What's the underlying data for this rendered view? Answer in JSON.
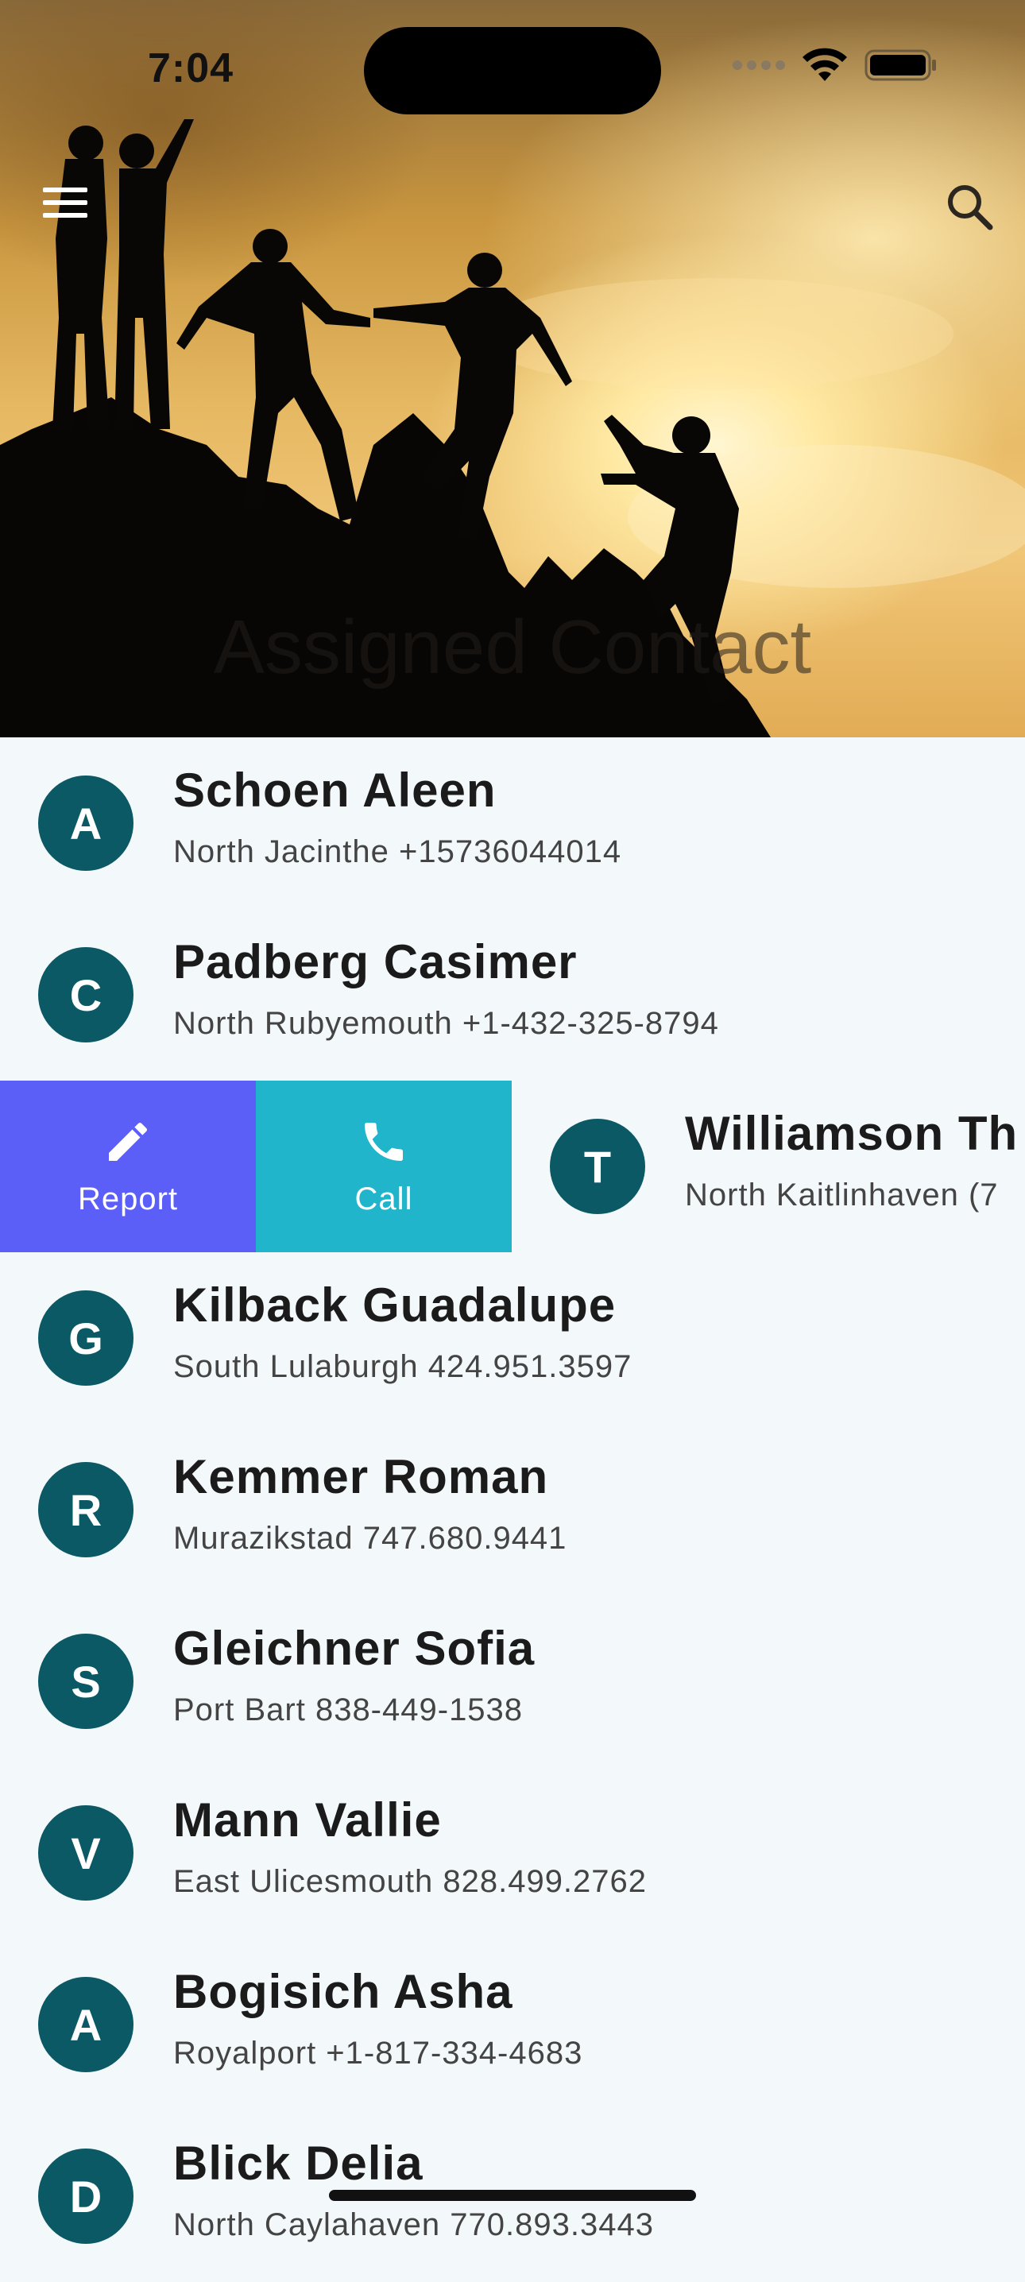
{
  "status_bar": {
    "time": "7:04"
  },
  "header": {
    "title": "Assigned Contact",
    "menu_icon": "hamburger-menu-icon",
    "search_icon": "search-icon"
  },
  "swipe_actions": {
    "report_label": "Report",
    "call_label": "Call"
  },
  "colors": {
    "avatar": "#0c5966",
    "report": "#5b5ff7",
    "call": "#21b5cc"
  },
  "contacts": [
    {
      "initial": "A",
      "name": "Schoen Aleen",
      "detail": "North Jacinthe +15736044014"
    },
    {
      "initial": "C",
      "name": "Padberg Casimer",
      "detail": "North Rubyemouth +1-432-325-8794"
    },
    {
      "initial": "T",
      "name": "Williamson Th",
      "detail": "North Kaitlinhaven (7"
    },
    {
      "initial": "G",
      "name": "Kilback Guadalupe",
      "detail": "South Lulaburgh 424.951.3597"
    },
    {
      "initial": "R",
      "name": "Kemmer Roman",
      "detail": "Murazikstad 747.680.9441"
    },
    {
      "initial": "S",
      "name": "Gleichner Sofia",
      "detail": "Port Bart 838-449-1538"
    },
    {
      "initial": "V",
      "name": "Mann Vallie",
      "detail": "East Ulicesmouth 828.499.2762"
    },
    {
      "initial": "A",
      "name": "Bogisich Asha",
      "detail": "Royalport +1-817-334-4683"
    },
    {
      "initial": "D",
      "name": "Blick Delia",
      "detail": "North Caylahaven 770.893.3443"
    }
  ]
}
